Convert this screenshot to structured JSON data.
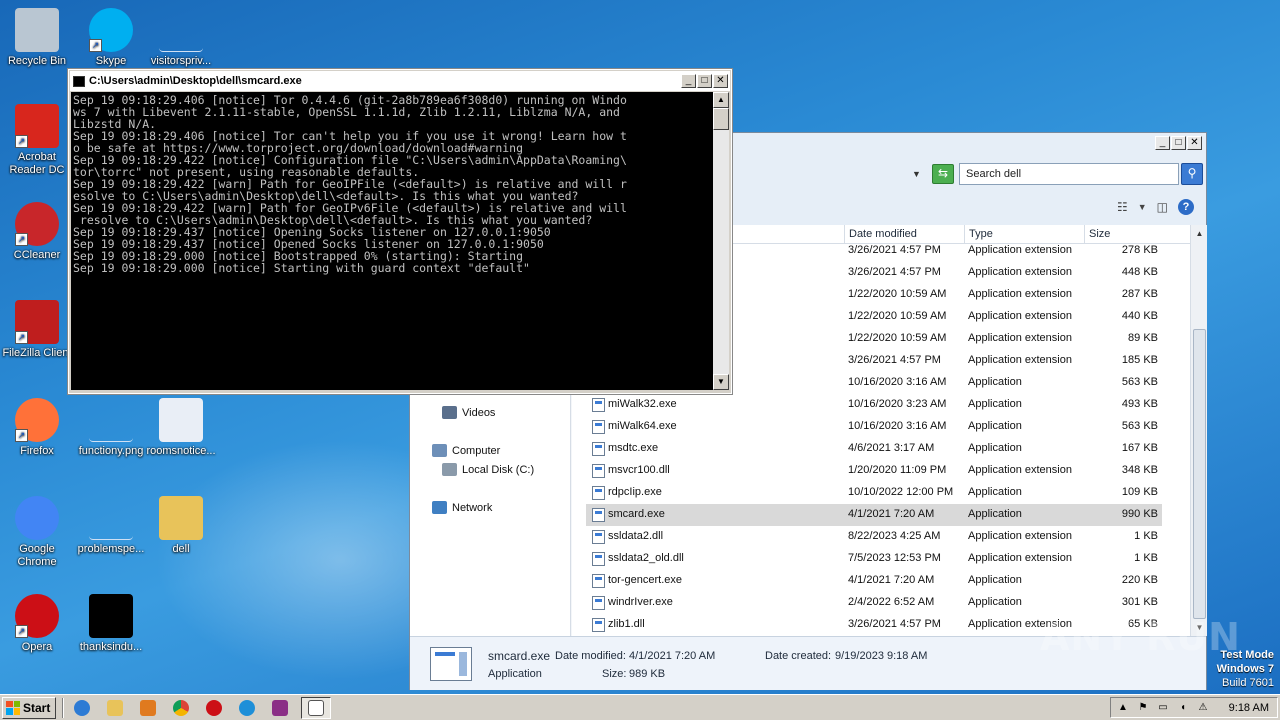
{
  "desktop": {
    "icons": [
      {
        "label": "Recycle Bin"
      },
      {
        "label": "Skype"
      },
      {
        "label": "visitorspriv..."
      },
      {
        "label": "Acrobat Reader DC"
      },
      {
        "label": "CCleaner"
      },
      {
        "label": "FileZilla Client"
      },
      {
        "label": "Firefox"
      },
      {
        "label": "functiony.png"
      },
      {
        "label": "roomsnotice..."
      },
      {
        "label": "Google Chrome"
      },
      {
        "label": "problemspe..."
      },
      {
        "label": "dell"
      },
      {
        "label": "Opera"
      },
      {
        "label": "thanksindu..."
      }
    ]
  },
  "console": {
    "title": "C:\\Users\\admin\\Desktop\\dell\\smcard.exe",
    "output": "Sep 19 09:18:29.406 [notice] Tor 0.4.4.6 (git-2a8b789ea6f308d0) running on Windo\nws 7 with Libevent 2.1.11-stable, OpenSSL 1.1.1d, Zlib 1.2.11, Liblzma N/A, and\nLibzstd N/A.\nSep 19 09:18:29.406 [notice] Tor can't help you if you use it wrong! Learn how t\no be safe at https://www.torproject.org/download/download#warning\nSep 19 09:18:29.422 [notice] Configuration file \"C:\\Users\\admin\\AppData\\Roaming\\\ntor\\torrc\" not present, using reasonable defaults.\nSep 19 09:18:29.422 [warn] Path for GeoIPFile (<default>) is relative and will r\nesolve to C:\\Users\\admin\\Desktop\\dell\\<default>. Is this what you wanted?\nSep 19 09:18:29.422 [warn] Path for GeoIPv6File (<default>) is relative and will\n resolve to C:\\Users\\admin\\Desktop\\dell\\<default>. Is this what you wanted?\nSep 19 09:18:29.437 [notice] Opening Socks listener on 127.0.0.1:9050\nSep 19 09:18:29.437 [notice] Opened Socks listener on 127.0.0.1:9050\nSep 19 09:18:29.000 [notice] Bootstrapped 0% (starting): Starting\nSep 19 09:18:29.000 [notice] Starting with guard context \"default\""
  },
  "explorer": {
    "search_placeholder": "Search dell",
    "columns": {
      "date": "Date modified",
      "type": "Type",
      "size": "Size"
    },
    "nav": [
      {
        "label": "Videos"
      },
      {
        "label": "Computer"
      },
      {
        "label": "Local Disk (C:)"
      },
      {
        "label": "Network"
      }
    ],
    "files": [
      {
        "name": "",
        "date": "3/26/2021 4:57 PM",
        "type": "Application extension",
        "size": "278 KB"
      },
      {
        "name": "",
        "date": "3/26/2021 4:57 PM",
        "type": "Application extension",
        "size": "448 KB"
      },
      {
        "name": "",
        "date": "1/22/2020 10:59 AM",
        "type": "Application extension",
        "size": "287 KB"
      },
      {
        "name": "",
        "date": "1/22/2020 10:59 AM",
        "type": "Application extension",
        "size": "440 KB"
      },
      {
        "name": "",
        "date": "1/22/2020 10:59 AM",
        "type": "Application extension",
        "size": "89 KB"
      },
      {
        "name": "",
        "date": "3/26/2021 4:57 PM",
        "type": "Application extension",
        "size": "185 KB"
      },
      {
        "name": "",
        "date": "10/16/2020 3:16 AM",
        "type": "Application",
        "size": "563 KB"
      },
      {
        "name": "miWalk32.exe",
        "date": "10/16/2020 3:23 AM",
        "type": "Application",
        "size": "493 KB"
      },
      {
        "name": "miWalk64.exe",
        "date": "10/16/2020 3:16 AM",
        "type": "Application",
        "size": "563 KB"
      },
      {
        "name": "msdtc.exe",
        "date": "4/6/2021 3:17 AM",
        "type": "Application",
        "size": "167 KB"
      },
      {
        "name": "msvcr100.dll",
        "date": "1/20/2020 11:09 PM",
        "type": "Application extension",
        "size": "348 KB"
      },
      {
        "name": "rdpcIip.exe",
        "date": "10/10/2022 12:00 PM",
        "type": "Application",
        "size": "109 KB"
      },
      {
        "name": "smcard.exe",
        "date": "4/1/2021 7:20 AM",
        "type": "Application",
        "size": "990 KB"
      },
      {
        "name": "ssldata2.dll",
        "date": "8/22/2023 4:25 AM",
        "type": "Application extension",
        "size": "1 KB"
      },
      {
        "name": "ssldata2_old.dll",
        "date": "7/5/2023 12:53 PM",
        "type": "Application extension",
        "size": "1 KB"
      },
      {
        "name": "tor-gencert.exe",
        "date": "4/1/2021 7:20 AM",
        "type": "Application",
        "size": "220 KB"
      },
      {
        "name": "windrIver.exe",
        "date": "2/4/2022 6:52 AM",
        "type": "Application",
        "size": "301 KB"
      },
      {
        "name": "zlib1.dll",
        "date": "3/26/2021 4:57 PM",
        "type": "Application extension",
        "size": "65 KB"
      }
    ],
    "selected_index": 12,
    "details": {
      "name": "smcard.exe",
      "modified_label": "Date modified:",
      "modified": "4/1/2021 7:20 AM",
      "created_label": "Date created:",
      "created": "9/19/2023 9:18 AM",
      "type": "Application",
      "size_label": "Size:",
      "size": "989 KB"
    }
  },
  "watermark": "ANY RUN",
  "test_mode": {
    "line1": "Test Mode",
    "line2": "Windows 7",
    "line3": "Build 7601"
  },
  "taskbar": {
    "start_label": "Start",
    "clock": "9:18 AM"
  }
}
